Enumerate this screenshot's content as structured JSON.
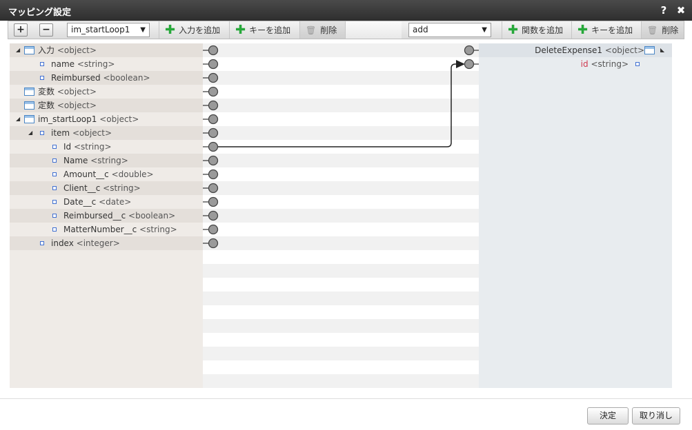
{
  "window": {
    "title": "マッピング設定",
    "help_label": "?",
    "close_label": "✖"
  },
  "toolbar": {
    "expand_label": "+",
    "collapse_label": "−",
    "left_select": "im_startLoop1",
    "add_input": "入力を追加",
    "add_key_left": "キーを追加",
    "delete_left": "削除",
    "right_select": "add",
    "add_function": "関数を追加",
    "add_key_right": "キーを追加",
    "delete_right": "削除"
  },
  "source_tree": [
    {
      "name": "入力",
      "type": "<object>",
      "expand": "◢",
      "icon": "object"
    },
    {
      "name": "name",
      "type": "<string>",
      "icon": "leaf"
    },
    {
      "name": "Reimbursed",
      "type": "<boolean>",
      "icon": "leaf"
    },
    {
      "name": "変数",
      "type": "<object>",
      "icon": "object"
    },
    {
      "name": "定数",
      "type": "<object>",
      "icon": "object"
    },
    {
      "name": "im_startLoop1",
      "type": "<object>",
      "expand": "◢",
      "icon": "object"
    },
    {
      "name": "item",
      "type": "<object>",
      "expand": "◢",
      "icon": "leaf"
    },
    {
      "name": "Id",
      "type": "<string>",
      "icon": "leaf"
    },
    {
      "name": "Name",
      "type": "<string>",
      "icon": "leaf"
    },
    {
      "name": "Amount__c",
      "type": "<double>",
      "icon": "leaf"
    },
    {
      "name": "Client__c",
      "type": "<string>",
      "icon": "leaf"
    },
    {
      "name": "Date__c",
      "type": "<date>",
      "icon": "leaf"
    },
    {
      "name": "Reimbursed__c",
      "type": "<boolean>",
      "icon": "leaf"
    },
    {
      "name": "MatterNumber__c",
      "type": "<string>",
      "icon": "leaf"
    },
    {
      "name": "index",
      "type": "<integer>",
      "icon": "leaf"
    }
  ],
  "target_tree": [
    {
      "name": "DeleteExpense1",
      "type": "<object>",
      "expand": "◣",
      "icon": "object"
    },
    {
      "name": "id",
      "type": "<string>",
      "icon": "leaf",
      "required": true
    }
  ],
  "mapping": {
    "from": "Id",
    "to": "id"
  },
  "footer": {
    "ok_label": "決定",
    "cancel_label": "取り消し"
  },
  "colors": {
    "title_bar": "#3a3a3a",
    "add_icon": "#27a83a",
    "required_field": "#d0384e",
    "connector_line": "#222222"
  }
}
